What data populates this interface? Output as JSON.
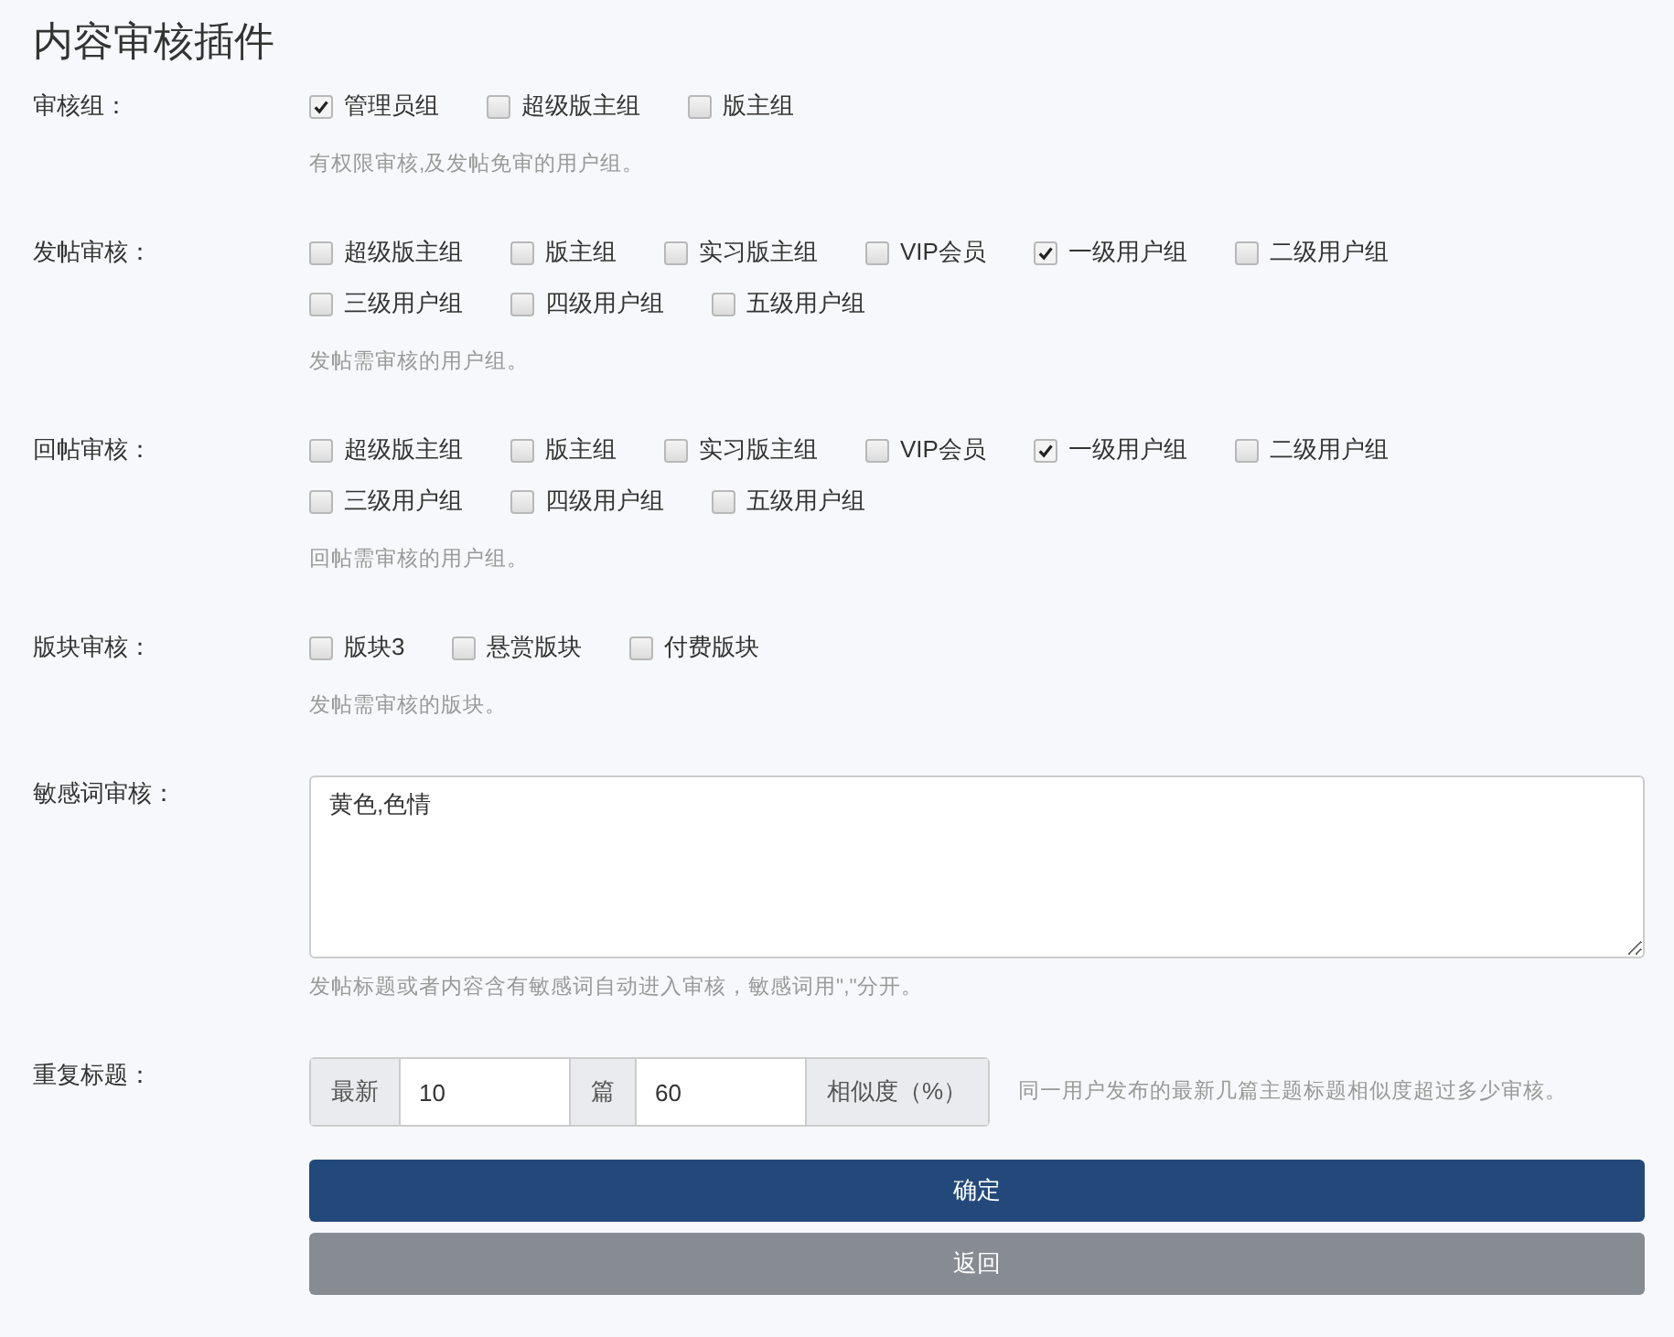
{
  "title": "内容审核插件",
  "sections": [
    {
      "kind": "checkboxes",
      "label": "审核组：",
      "options": [
        {
          "label": "管理员组",
          "checked": true
        },
        {
          "label": "超级版主组",
          "checked": false
        },
        {
          "label": "版主组",
          "checked": false
        }
      ],
      "help": "有权限审核,及发帖免审的用户组。"
    },
    {
      "kind": "checkboxes",
      "label": "发帖审核：",
      "options": [
        {
          "label": "超级版主组",
          "checked": false
        },
        {
          "label": "版主组",
          "checked": false
        },
        {
          "label": "实习版主组",
          "checked": false
        },
        {
          "label": "VIP会员",
          "checked": false
        },
        {
          "label": "一级用户组",
          "checked": true
        },
        {
          "label": "二级用户组",
          "checked": false
        },
        {
          "label": "三级用户组",
          "checked": false
        },
        {
          "label": "四级用户组",
          "checked": false
        },
        {
          "label": "五级用户组",
          "checked": false
        }
      ],
      "help": "发帖需审核的用户组。"
    },
    {
      "kind": "checkboxes",
      "label": "回帖审核：",
      "options": [
        {
          "label": "超级版主组",
          "checked": false
        },
        {
          "label": "版主组",
          "checked": false
        },
        {
          "label": "实习版主组",
          "checked": false
        },
        {
          "label": "VIP会员",
          "checked": false
        },
        {
          "label": "一级用户组",
          "checked": true
        },
        {
          "label": "二级用户组",
          "checked": false
        },
        {
          "label": "三级用户组",
          "checked": false
        },
        {
          "label": "四级用户组",
          "checked": false
        },
        {
          "label": "五级用户组",
          "checked": false
        }
      ],
      "help": "回帖需审核的用户组。"
    },
    {
      "kind": "checkboxes",
      "label": "版块审核：",
      "options": [
        {
          "label": "版块3",
          "checked": false
        },
        {
          "label": "悬赏版块",
          "checked": false
        },
        {
          "label": "付费版块",
          "checked": false
        }
      ],
      "help": "发帖需审核的版块。"
    },
    {
      "kind": "textarea",
      "label": "敏感词审核：",
      "value": "黄色,色情",
      "help": "发帖标题或者内容含有敏感词自动进入审核，敏感词用\",\"分开。"
    },
    {
      "kind": "inputgroup",
      "label": "重复标题：",
      "parts": [
        {
          "kind": "addon",
          "text": "最新"
        },
        {
          "kind": "input",
          "value": "10"
        },
        {
          "kind": "addon",
          "text": "篇"
        },
        {
          "kind": "input",
          "value": "60"
        },
        {
          "kind": "addon",
          "text": "相似度（%）"
        }
      ],
      "help": "同一用户发布的最新几篇主题标题相似度超过多少审核。"
    }
  ],
  "buttons": [
    {
      "kind": "primary",
      "label": "确定"
    },
    {
      "kind": "secondary",
      "label": "返回"
    }
  ]
}
